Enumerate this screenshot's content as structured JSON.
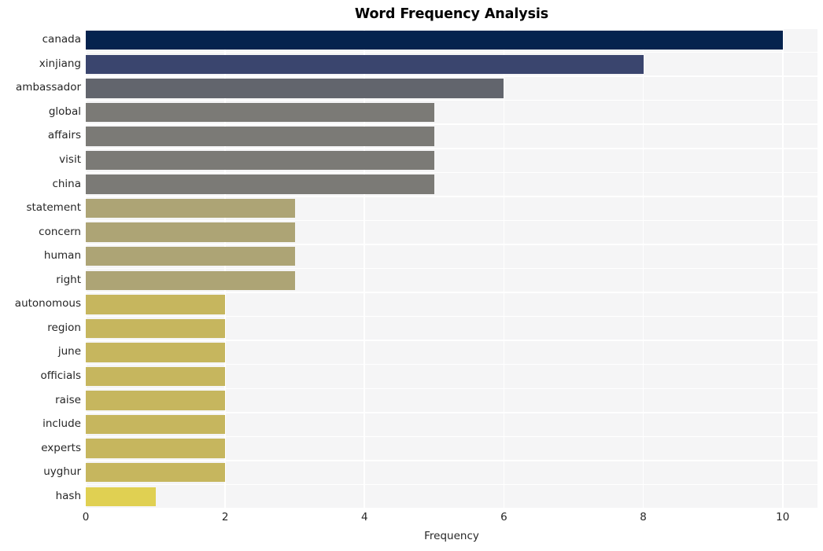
{
  "chart_data": {
    "type": "bar",
    "orientation": "horizontal",
    "title": "Word Frequency Analysis",
    "xlabel": "Frequency",
    "ylabel": "",
    "xlim": [
      0,
      10.5
    ],
    "xticks": [
      0,
      2,
      4,
      6,
      8,
      10
    ],
    "xtick_labels": [
      "0",
      "2",
      "4",
      "6",
      "8",
      "10"
    ],
    "grid": true,
    "legend": null,
    "categories": [
      "canada",
      "xinjiang",
      "ambassador",
      "global",
      "affairs",
      "visit",
      "china",
      "statement",
      "concern",
      "human",
      "right",
      "autonomous",
      "region",
      "june",
      "officials",
      "raise",
      "include",
      "experts",
      "uyghur",
      "hash"
    ],
    "values": [
      10,
      8,
      6,
      5,
      5,
      5,
      5,
      3,
      3,
      3,
      3,
      2,
      2,
      2,
      2,
      2,
      2,
      2,
      2,
      1
    ],
    "bar_colors": [
      "#05234e",
      "#3a456e",
      "#62656d",
      "#7b7a76",
      "#7b7a76",
      "#7b7a76",
      "#7b7a76",
      "#ada475",
      "#ada475",
      "#ada475",
      "#ada475",
      "#c6b65e",
      "#c6b65e",
      "#c6b65e",
      "#c6b65e",
      "#c6b65e",
      "#c6b65e",
      "#c6b65e",
      "#c6b65e",
      "#e0d052"
    ],
    "plot_background": "#f5f5f6",
    "gridline_color": "#ffffff",
    "figure_background": "#ffffff"
  }
}
